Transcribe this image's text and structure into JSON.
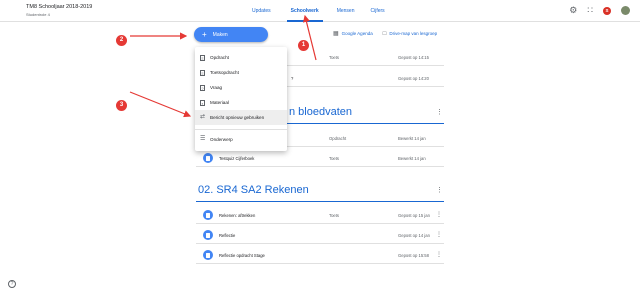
{
  "header": {
    "title": "TM8 Schooljaar 2018-2019",
    "subtitle": "Studentrole 4",
    "tabs": [
      {
        "label": "Updates"
      },
      {
        "label": "Schoolwerk"
      },
      {
        "label": "Mensen"
      },
      {
        "label": "Cijfers"
      }
    ],
    "active_tab": "Schoolwerk",
    "avatar_badge": "S",
    "icons": [
      "gear-icon",
      "apps-grid-icon",
      "account-avatar"
    ]
  },
  "toolbar": {
    "create_label": "Maken",
    "links": [
      {
        "label": "Google Agenda",
        "icon": "calendar-icon"
      },
      {
        "label": "Drive-map van lesgroep",
        "icon": "folder-icon"
      }
    ]
  },
  "create_menu": {
    "items": [
      {
        "label": "Opdracht",
        "icon": "assignment-icon"
      },
      {
        "label": "Toetsopdracht",
        "icon": "quiz-icon"
      },
      {
        "label": "Vraag",
        "icon": "question-icon"
      },
      {
        "label": "Materiaal",
        "icon": "material-icon"
      },
      {
        "label": "Bericht opnieuw gebruiken",
        "icon": "reuse-icon"
      },
      {
        "label": "Onderwerp",
        "icon": "topic-icon"
      }
    ],
    "highlighted": "Bericht opnieuw gebruiken"
  },
  "stream_top": [
    {
      "title": "",
      "type": "Toets",
      "date": "Gepost op 14:15"
    },
    {
      "title": "?",
      "type": "",
      "date": "Gepost op 14:20"
    }
  ],
  "topics": [
    {
      "title": "n bloedvaten",
      "items": [
        {
          "title": "",
          "type": "Opdracht",
          "date": "Bewerkt 14 jan"
        },
        {
          "title": "Testquiz Cijferboek",
          "type": "Toets",
          "date": "Bewerkt 14 jan"
        }
      ]
    },
    {
      "title": "02. SR4 SA2 Rekenen",
      "items": [
        {
          "title": "Rekenen: aftrekken",
          "type": "Toets",
          "date": "Gepost op 15 jan"
        },
        {
          "title": "Reflectie",
          "type": "",
          "date": "Gepost op 14 jan"
        },
        {
          "title": "Reflectie opdracht Stage",
          "type": "",
          "date": "Gepost op 15:58"
        }
      ]
    }
  ],
  "annotations": [
    {
      "label": "1",
      "color": "#e53935"
    },
    {
      "label": "2",
      "color": "#e53935"
    },
    {
      "label": "3",
      "color": "#e53935"
    }
  ],
  "help_label": "?"
}
